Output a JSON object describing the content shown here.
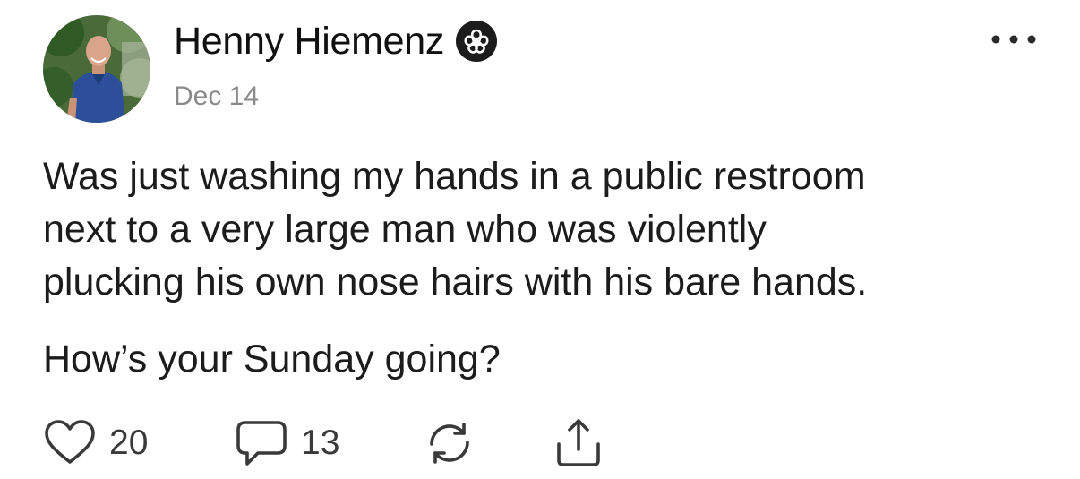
{
  "post": {
    "author": {
      "name": "Henny Hiemenz",
      "badge_icon": "flower-badge-icon",
      "avatar": "profile-photo"
    },
    "date": "Dec 14",
    "menu_icon": "more-dots-icon",
    "body": {
      "paragraph_1": "Was just washing my hands in a public restroom\nnext to a very large man who was violently\nplucking his own nose hairs with his bare hands.",
      "paragraph_2": "How’s your Sunday going?"
    },
    "actions": {
      "like": {
        "icon": "heart-icon",
        "count": "20"
      },
      "comment": {
        "icon": "comment-bubble-icon",
        "count": "13"
      },
      "restack": {
        "icon": "restack-arrows-icon"
      },
      "share": {
        "icon": "share-icon"
      }
    }
  },
  "colors": {
    "text": "#1c1c1c",
    "muted": "#8a8a8a",
    "icon": "#3a3a3a",
    "background": "#ffffff"
  }
}
